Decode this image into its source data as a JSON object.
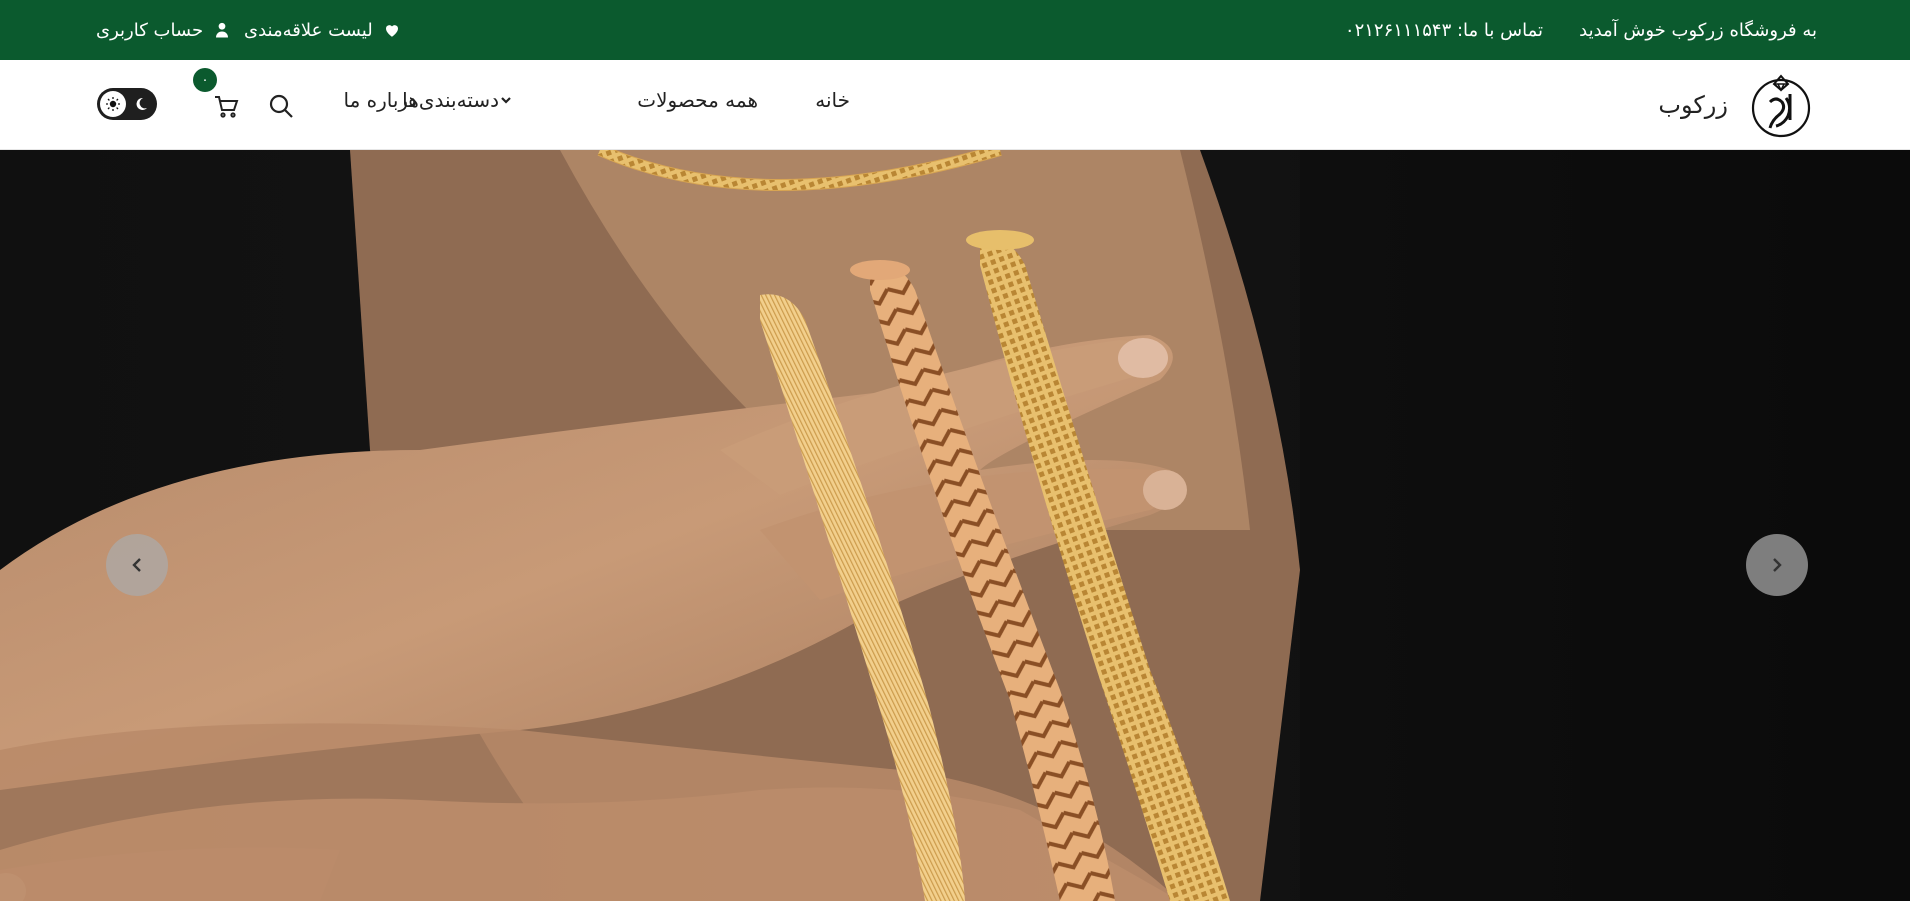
{
  "topbar": {
    "welcome": "به فروشگاه زرکوب خوش آمدید",
    "contact": "تماس با ما: ۰۲۱۲۶۱۱۱۵۴۳",
    "wishlist": "لیست علاقه‌مندی",
    "account": "حساب کاربری",
    "wishlist_icon": "heart-icon",
    "account_icon": "user-icon"
  },
  "header": {
    "brand_name": "زرکوب",
    "logo_icon": "brand-logo-icon",
    "nav": {
      "home": "خانه",
      "all_products": "همه محصولات",
      "categories": "دسته‌بندی‌ها",
      "about": "درباره ما"
    },
    "cart_count": "۰",
    "search_icon": "search-icon",
    "cart_icon": "cart-icon",
    "theme_toggle_icons": [
      "sun-icon",
      "moon-icon"
    ]
  },
  "hero": {
    "prev_icon": "chevron-left-icon",
    "next_icon": "chevron-right-icon",
    "image_subject": "gold bracelets on hands"
  },
  "colors": {
    "brand_green": "#0b5a2e",
    "hero_bg": "#0d0d0d",
    "skin": "#c49470",
    "gold": "#e2b96a"
  }
}
